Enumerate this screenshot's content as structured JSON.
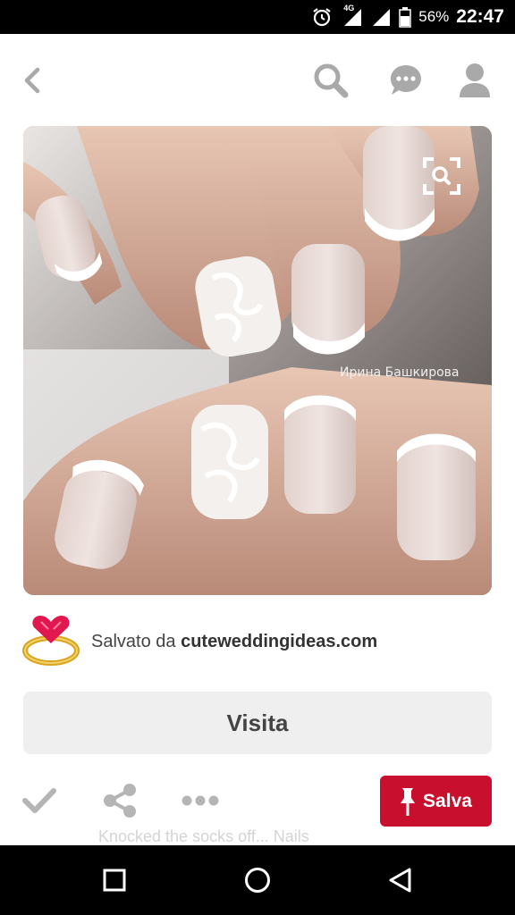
{
  "status_bar": {
    "network": "4G",
    "battery": "56%",
    "time": "22:47"
  },
  "toolbar": {
    "icons": [
      "back-icon",
      "search-icon",
      "comment-icon",
      "profile-icon"
    ]
  },
  "pin": {
    "watermark": "Ирина Башкирова",
    "lens_icon": "visual-search-icon"
  },
  "saved_from": {
    "prefix": "Salvato da",
    "domain": "cuteweddingideas.com"
  },
  "visit_button": {
    "label": "Visita"
  },
  "actions": {
    "icons": [
      "check-icon",
      "share-icon",
      "more-icon"
    ],
    "save_label": "Salva"
  },
  "partial_text": "Knocked the socks off... Nails",
  "colors": {
    "save_red": "#c8102e",
    "icon_gray": "#b5b5b5",
    "visit_bg": "#efefef"
  }
}
